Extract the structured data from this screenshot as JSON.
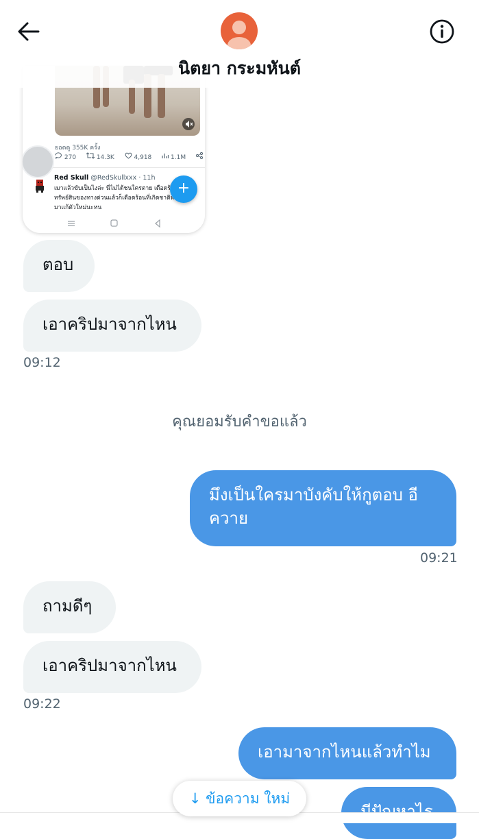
{
  "header": {
    "contact_name": "นิตยา กระมหันต์"
  },
  "shared_screenshot": {
    "views": "ยอดดู 355K ครั้ง",
    "stats": {
      "replies": "270",
      "retweets": "14.3K",
      "likes": "4,918",
      "views": "1.1M"
    },
    "tweet": {
      "author": "Red Skull",
      "handle_time": "@RedSkullxxx · 11h",
      "text": "เมาแล้วขับเป็นไงล่ะ นี่ไม่ได้ชนใครตาย เดือดร้อนทรัพย์สินของทางด่วนแล้วก็เดือดร้อนที่เกิดชาติหน้าค่อยมาแก้ตัวใหม่นะหน"
    },
    "fab_label": "+"
  },
  "messages": [
    {
      "id": "m1",
      "direction": "received",
      "text": "ตอบ"
    },
    {
      "id": "m2",
      "direction": "received",
      "text": "เอาคริปมาจากไหน",
      "time": "09:12"
    },
    {
      "id": "m3",
      "direction": "sent",
      "text": "มึงเป็นใครมาบังคับให้กูตอบ อีควาย",
      "time": "09:21"
    },
    {
      "id": "m4",
      "direction": "received",
      "text": "ถามดีๆ"
    },
    {
      "id": "m5",
      "direction": "received",
      "text": "เอาคริปมาจากไหน",
      "time": "09:22"
    },
    {
      "id": "m6",
      "direction": "sent",
      "text": "เอามาจากไหนแล้วทำไม"
    },
    {
      "id": "m7",
      "direction": "sent",
      "text": "มีปัญหาไร"
    }
  ],
  "system_message": "คุณยอมรับคำขอแล้ว",
  "new_messages_button": "↓ ข้อความ ใหม่",
  "colors": {
    "sent_bubble": "#4a97e6",
    "received_bubble": "#eff3f4",
    "accent": "#1d9bf0",
    "avatar_bg": "#e8623a"
  },
  "icons": [
    "back-arrow-icon",
    "info-icon",
    "mute-icon",
    "reply-icon",
    "retweet-icon",
    "like-icon",
    "analytics-icon",
    "share-icon"
  ]
}
